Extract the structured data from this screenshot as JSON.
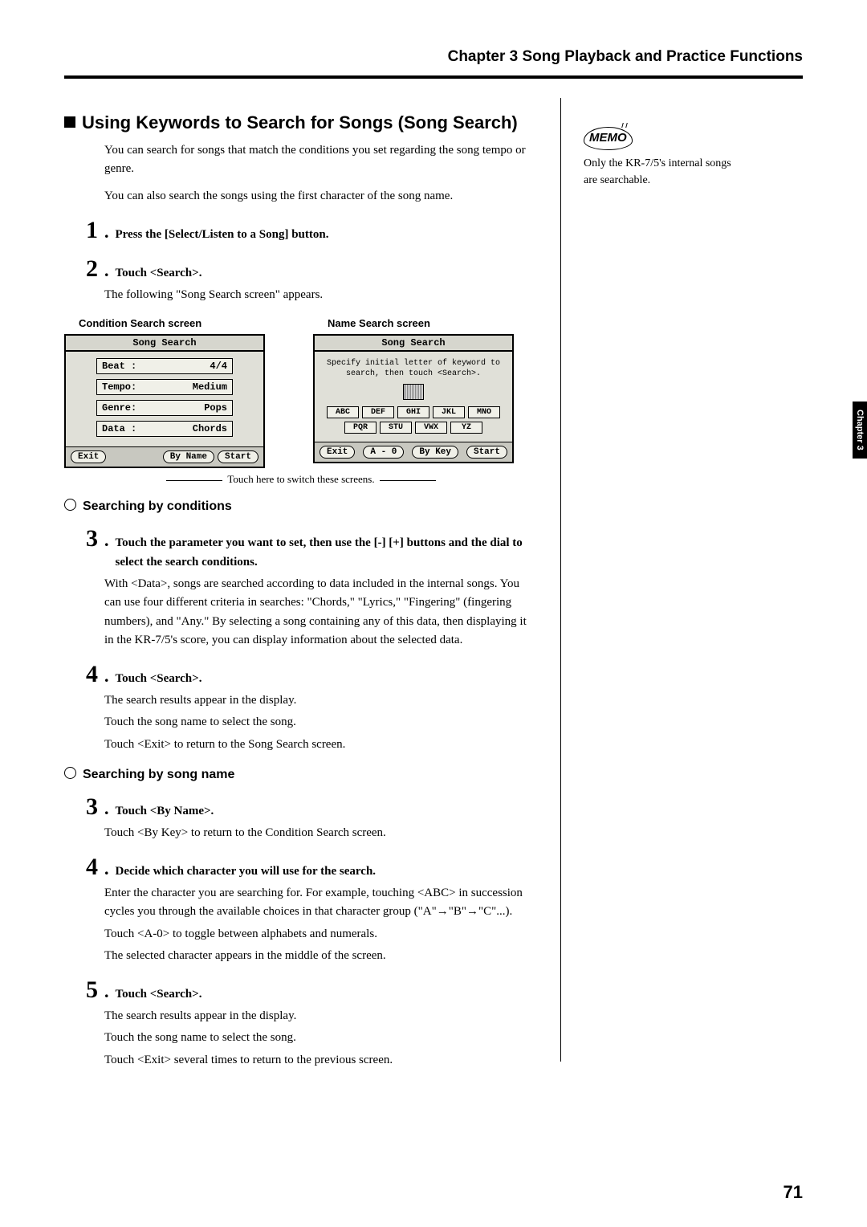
{
  "chapter_header": "Chapter 3 Song Playback and Practice Functions",
  "section_title": "Using Keywords to Search for Songs (Song Search)",
  "intro": {
    "p1": "You can search for songs that match the conditions you set regarding the song tempo or genre.",
    "p2": "You can also search the songs using the first character of the song name."
  },
  "memo": {
    "label": "MEMO",
    "text": "Only the KR-7/5's internal songs are searchable."
  },
  "steps_top": {
    "s1": {
      "num": "1",
      "text": "Press the [Select/Listen to a Song] button."
    },
    "s2": {
      "num": "2",
      "text": "Touch <Search>.",
      "body": "The following \"Song Search screen\" appears."
    }
  },
  "screens": {
    "cond": {
      "caption": "Condition Search screen",
      "title": "Song Search",
      "rows": {
        "beat": {
          "label": "Beat :",
          "value": "4/4"
        },
        "tempo": {
          "label": "Tempo:",
          "value": "Medium"
        },
        "genre": {
          "label": "Genre:",
          "value": "Pops"
        },
        "data": {
          "label": "Data :",
          "value": "Chords"
        }
      },
      "buttons": {
        "exit": "Exit",
        "byname": "By Name",
        "start": "Start"
      }
    },
    "name": {
      "caption": "Name Search screen",
      "title": "Song Search",
      "instr": "Specify initial letter of keyword to search, then touch <Search>.",
      "keys": {
        "abc": "ABC",
        "def": "DEF",
        "ghi": "GHI",
        "jkl": "JKL",
        "mno": "MNO",
        "pqr": "PQR",
        "stu": "STU",
        "vwx": "VWX",
        "yz": "YZ"
      },
      "buttons": {
        "exit": "Exit",
        "a0": "A - 0",
        "bykey": "By Key",
        "start": "Start"
      }
    },
    "switch_note": "Touch here to switch these screens."
  },
  "sub1": {
    "heading": "Searching by conditions",
    "s3": {
      "num": "3",
      "text": "Touch the parameter you want to set, then use the [-] [+] buttons and the dial to select the search conditions.",
      "body1": "With <Data>, songs are searched according to data included in the internal songs. You can use four different criteria in searches: \"Chords,\" \"Lyrics,\" \"Fingering\" (fingering numbers), and \"Any.\" By selecting a song containing any of this data, then displaying it in the KR-7/5's score, you can display information about the selected data."
    },
    "s4": {
      "num": "4",
      "text": "Touch <Search>.",
      "body1": "The search results appear in the display.",
      "body2": "Touch the song name to select the song.",
      "body3": "Touch <Exit> to return to the Song Search screen."
    }
  },
  "sub2": {
    "heading": "Searching by song name",
    "s3b": {
      "num": "3",
      "text": "Touch <By Name>.",
      "body": "Touch <By Key> to return to the Condition Search screen."
    },
    "s4b": {
      "num": "4",
      "text": "Decide which character you will use for the search.",
      "body1": "Enter the character you are searching for. For example, touching <ABC> in succession cycles you through the available choices in that character group (\"A\"→\"B\"→\"C\"...).",
      "body2": "Touch <A-0> to toggle between alphabets and numerals.",
      "body3": "The selected character appears in the middle of the screen."
    },
    "s5": {
      "num": "5",
      "text": "Touch <Search>.",
      "body1": "The search results appear in the display.",
      "body2": "Touch the song name to select the song.",
      "body3": "Touch <Exit> several times to return to the previous screen."
    }
  },
  "side_tab": "Chapter 3",
  "page_number": "71"
}
